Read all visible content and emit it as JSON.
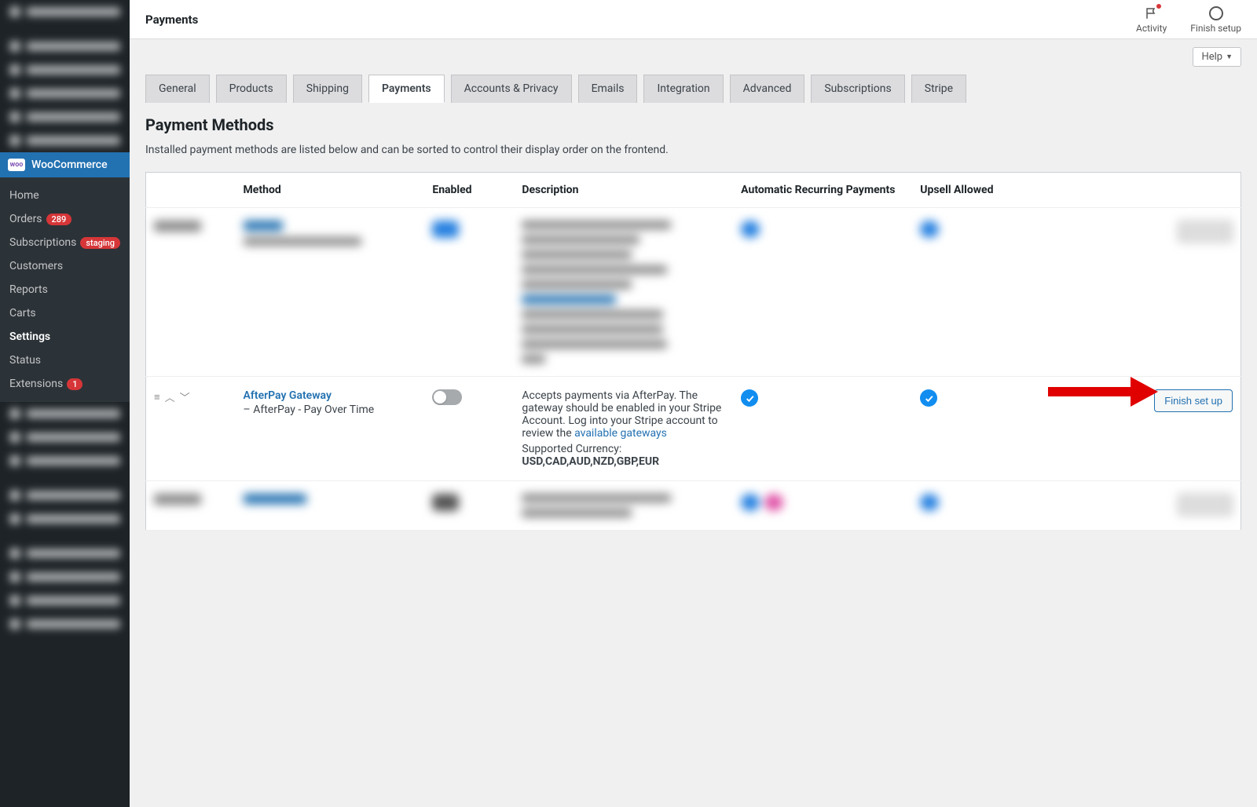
{
  "sidebar": {
    "woo": {
      "icon_text": "woo",
      "label": "WooCommerce"
    },
    "submenu": [
      {
        "label": "Home",
        "active": false
      },
      {
        "label": "Orders",
        "badge": "289",
        "active": false
      },
      {
        "label": "Subscriptions",
        "badge": "staging",
        "active": false
      },
      {
        "label": "Customers",
        "active": false
      },
      {
        "label": "Reports",
        "active": false
      },
      {
        "label": "Carts",
        "active": false
      },
      {
        "label": "Settings",
        "active": true
      },
      {
        "label": "Status",
        "active": false
      },
      {
        "label": "Extensions",
        "badge": "1",
        "active": false
      }
    ]
  },
  "topbar": {
    "title": "Payments",
    "activity": "Activity",
    "finish_setup": "Finish setup",
    "help": "Help"
  },
  "tabs": [
    "General",
    "Products",
    "Shipping",
    "Payments",
    "Accounts & Privacy",
    "Emails",
    "Integration",
    "Advanced",
    "Subscriptions",
    "Stripe"
  ],
  "active_tab": "Payments",
  "section": {
    "title": "Payment Methods",
    "desc": "Installed payment methods are listed below and can be sorted to control their display order on the frontend."
  },
  "columns": {
    "method": "Method",
    "enabled": "Enabled",
    "description": "Description",
    "auto": "Automatic Recurring Payments",
    "upsell": "Upsell Allowed"
  },
  "afterpay": {
    "name": "AfterPay Gateway",
    "sub": "– AfterPay - Pay Over Time",
    "desc_line1": "Accepts payments via AfterPay. The gateway should be enabled in your Stripe Account. Log into your Stripe account to review the ",
    "gateways_link": "available gateways",
    "supported_label": "Supported Currency:",
    "currencies": "USD,CAD,AUD,NZD,GBP,EUR",
    "action": "Finish set up"
  }
}
